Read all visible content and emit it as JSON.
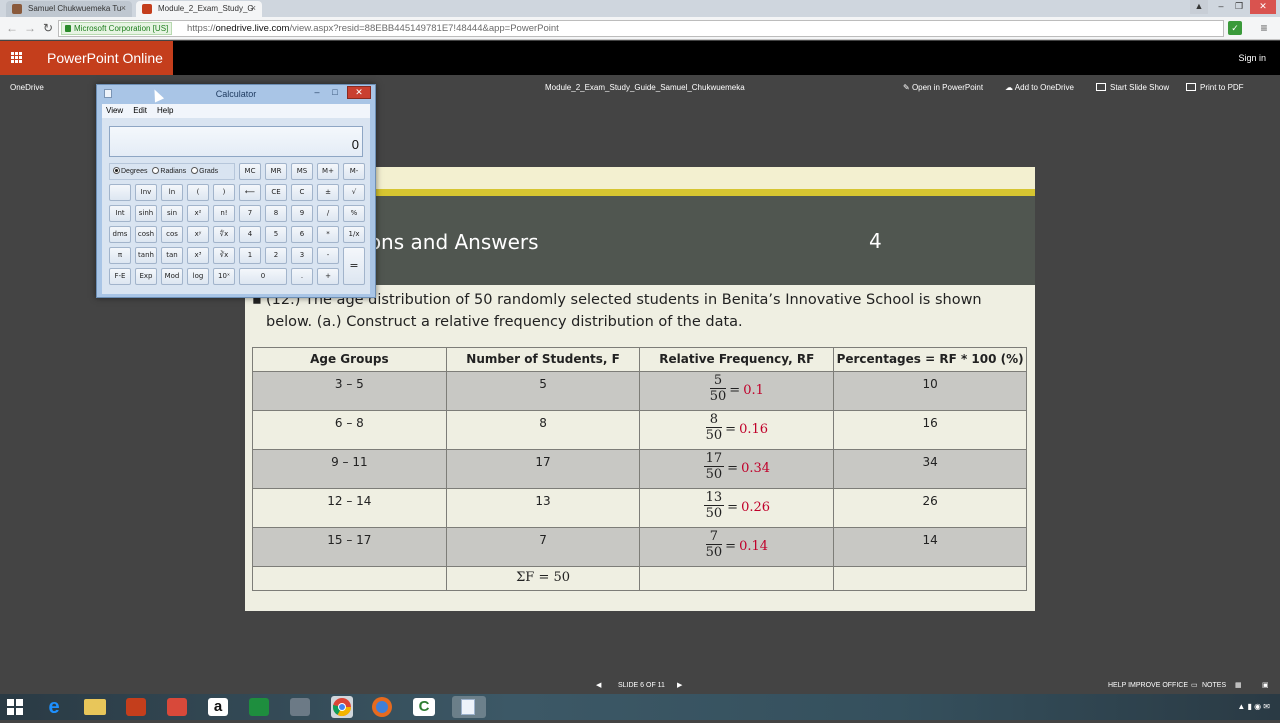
{
  "browser": {
    "tabs": [
      {
        "label": "Samuel Chukwuemeka Tu",
        "active": false
      },
      {
        "label": "Module_2_Exam_Study_G",
        "active": true
      }
    ],
    "certificate": "Microsoft Corporation [US]",
    "url_scheme": "https://",
    "url_domain": "onedrive.live.com",
    "url_rest": "/view.aspx?resid=88EBB445149781E7!48444&app=PowerPoint"
  },
  "office": {
    "app_title": "PowerPoint Online",
    "sign_in": "Sign in",
    "breadcrumb": "OneDrive",
    "document_title": "Module_2_Exam_Study_Guide_Samuel_Chukwuemeka",
    "actions": {
      "open": "Open in PowerPoint",
      "add": "Add to OneDrive",
      "slideshow": "Start Slide Show",
      "print": "Print to PDF"
    }
  },
  "calculator": {
    "title": "Calculator",
    "menu": {
      "view": "View",
      "edit": "Edit",
      "help": "Help"
    },
    "display": "0",
    "modes": {
      "degrees": "Degrees",
      "radians": "Radians",
      "grads": "Grads",
      "selected": "Degrees"
    },
    "keys": {
      "mc": "MC",
      "mr": "MR",
      "ms": "MS",
      "mplus": "M+",
      "mminus": "M-",
      "inv": "Inv",
      "ln": "ln",
      "lparen": "(",
      "rparen": ")",
      "back": "⟵",
      "ce": "CE",
      "c": "C",
      "pm": "±",
      "sqrt": "√",
      "int": "Int",
      "sinh": "sinh",
      "sin": "sin",
      "x2": "x²",
      "fact": "n!",
      "k7": "7",
      "k8": "8",
      "k9": "9",
      "div": "/",
      "pct": "%",
      "dms": "dms",
      "cosh": "cosh",
      "cos": "cos",
      "xy": "xʸ",
      "yroot": "∜x",
      "k4": "4",
      "k5": "5",
      "k6": "6",
      "mul": "*",
      "recip": "1/x",
      "pi": "π",
      "tanh": "tanh",
      "tan": "tan",
      "x3": "x³",
      "cbrt": "∛x",
      "k1": "1",
      "k2": "2",
      "k3": "3",
      "sub": "-",
      "eq": "=",
      "fe": "F-E",
      "exp": "Exp",
      "mod": "Mod",
      "log": "log",
      "tenx": "10ˣ",
      "k0": "0",
      "dot": ".",
      "add": "+"
    }
  },
  "slide": {
    "title": "stions and Answers",
    "number": "4",
    "question_line1": "(12.)   The age distribution of 50 randomly selected students in Benita’s Innovative School is shown",
    "question_line2": "below. (a.) Construct a relative frequency distribution of the data.",
    "table": {
      "headers": [
        "Age Groups",
        "Number of Students, F",
        "Relative Frequency, RF",
        "Percentages = RF * 100 (%)"
      ],
      "rows": [
        {
          "age": "3 – 5",
          "f": "5",
          "num": "5",
          "den": "50",
          "rf": "0.1",
          "pct": "10"
        },
        {
          "age": "6 – 8",
          "f": "8",
          "num": "8",
          "den": "50",
          "rf": "0.16",
          "pct": "16"
        },
        {
          "age": "9 – 11",
          "f": "17",
          "num": "17",
          "den": "50",
          "rf": "0.34",
          "pct": "34"
        },
        {
          "age": "12 – 14",
          "f": "13",
          "num": "13",
          "den": "50",
          "rf": "0.26",
          "pct": "26"
        },
        {
          "age": "15 – 17",
          "f": "7",
          "num": "7",
          "den": "50",
          "rf": "0.14",
          "pct": "14"
        }
      ],
      "sum": "ΣF = 50"
    }
  },
  "status": {
    "slide_counter": "SLIDE 6 OF 11",
    "help": "HELP IMPROVE OFFICE",
    "notes": "NOTES"
  },
  "colors": {
    "office_brand": "#c43e1c",
    "slide_band": "#505650",
    "accent_stripe": "#d6c531",
    "rf_value": "#c0002a"
  }
}
